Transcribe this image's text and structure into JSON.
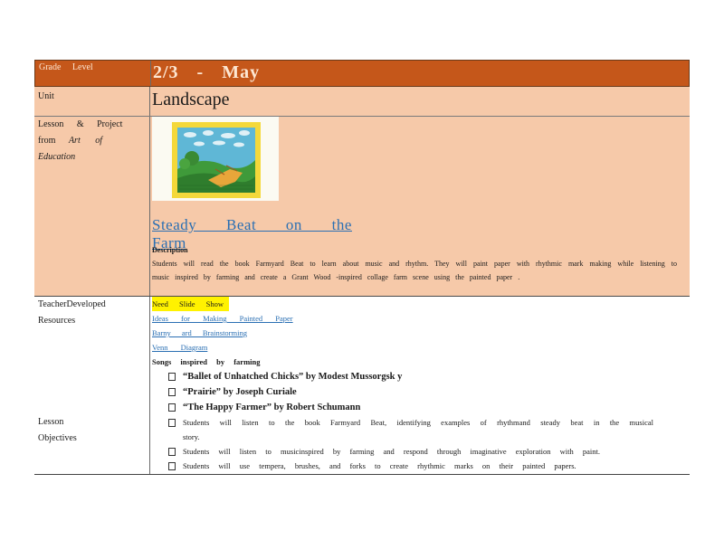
{
  "grade": {
    "label": "Grade Level",
    "value": "2/3 - May"
  },
  "unit": {
    "label": "Unit",
    "value": "Landscape"
  },
  "lesson": {
    "label_line1": "Lesson & Project",
    "label_from": "from",
    "label_source": "Art of Education",
    "title": "Steady Beat on the Farm",
    "description_heading": "Description",
    "description_text": "Students will read the book Farmyard Beat to learn about music and rhythm. They will paint paper with rhythmic mark making while listening to music inspired by farming and create a Grant Wood -inspired collage farm scene using the painted paper ."
  },
  "resources": {
    "label": "TeacherDeveloped Resources",
    "highlight": "Need Slide Show",
    "links": [
      "Ideas for Making Painted Paper",
      "Barny ard Brainstorming",
      "Venn Diagram"
    ],
    "songs_heading": "Songs inspired by farming",
    "songs": [
      "“Ballet of Unhatched Chicks” by Modest Mussorgsk y",
      "“Prairie” by Joseph Curiale",
      "“The Happy Farmer” by Robert Schumann"
    ]
  },
  "objectives": {
    "label": "Lesson Objectives",
    "items": [
      "Students will listen to the book Farmyard Beat, identifying examples of rhythmand steady beat in the musical story.",
      "Students will listen to musicinspired by farming and respond through imaginative exploration with paint.",
      "Students will use tempera, brushes, and forks to create rhythmic marks on their painted papers."
    ]
  },
  "colors": {
    "header": "#c5571a",
    "band": "#f6c9a9",
    "link": "#2a6fb3",
    "highlight": "#fff200"
  }
}
